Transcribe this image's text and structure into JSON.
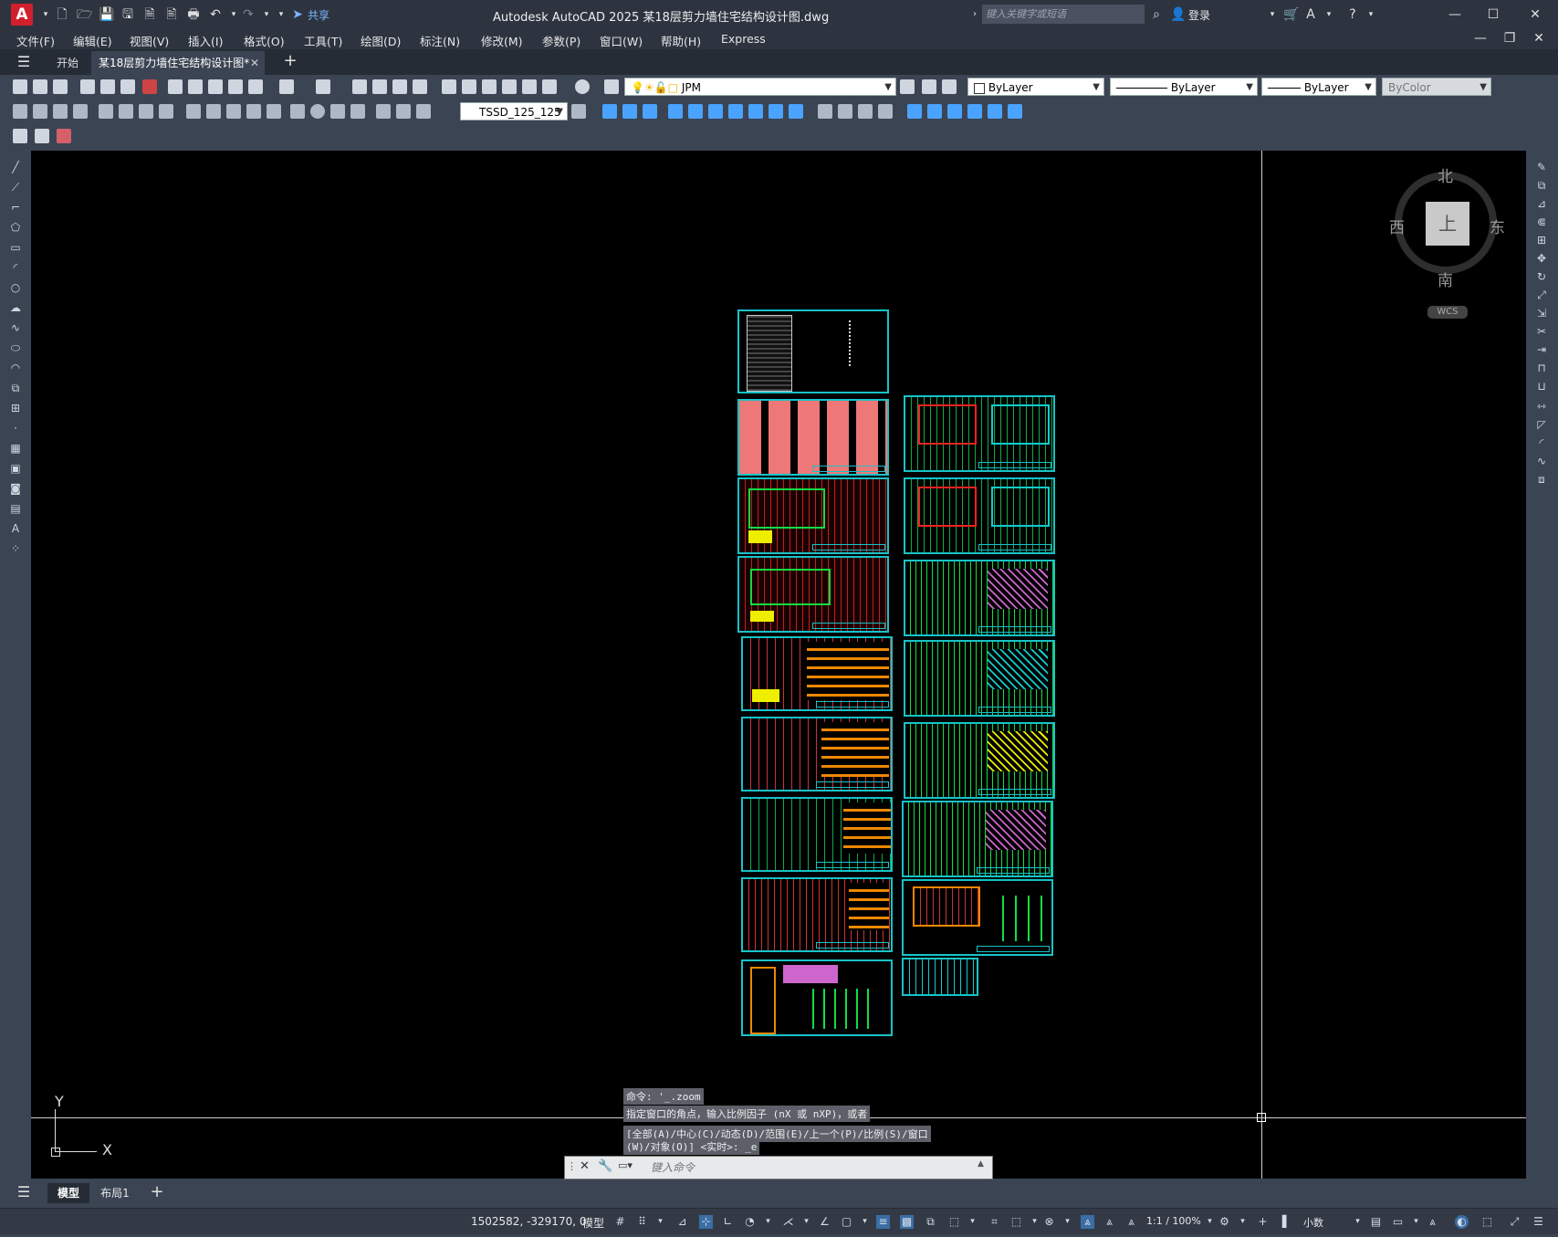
{
  "app": {
    "title": "Autodesk AutoCAD 2025    某18层剪力墙住宅结构设计图.dwg",
    "logo": "A",
    "share_label": "共享",
    "search_placeholder": "键入关键字或短语",
    "login_label": "登录"
  },
  "menu": [
    "文件(F)",
    "编辑(E)",
    "视图(V)",
    "插入(I)",
    "格式(O)",
    "工具(T)",
    "绘图(D)",
    "标注(N)",
    "修改(M)",
    "参数(P)",
    "窗口(W)",
    "帮助(H)",
    "Express"
  ],
  "tabs": {
    "start": "开始",
    "doc": "某18层剪力墙住宅结构设计图*"
  },
  "properties": {
    "layer": "JPM",
    "color": "ByLayer",
    "linetype": "ByLayer",
    "lineweight": "ByLayer",
    "plotstyle": "ByColor",
    "dimstyle": "TSSD_125_125"
  },
  "viewcube": {
    "north": "北",
    "south": "南",
    "east": "东",
    "west": "西",
    "top": "上",
    "wcs": "WCS"
  },
  "ucs": {
    "x": "X",
    "y": "Y"
  },
  "command": {
    "history": [
      "命令: '_.zoom",
      "指定窗口的角点，输入比例因子 (nX 或 nXP)，或者",
      "[全部(A)/中心(C)/动态(D)/范围(E)/上一个(P)/比例(S)/窗口",
      "(W)/对象(O)] <实时>: _e"
    ],
    "placeholder": "键入命令"
  },
  "layout_tabs": {
    "model": "模型",
    "layout1": "布局1"
  },
  "status": {
    "coords": "1502582, -329170, 0",
    "model": "模型",
    "scale": "1:1 / 100%",
    "units": "小数"
  },
  "colors": {
    "canvas_bg": "#000000",
    "sheet_border": "#17c3c8",
    "chrome": "#3b4453"
  }
}
